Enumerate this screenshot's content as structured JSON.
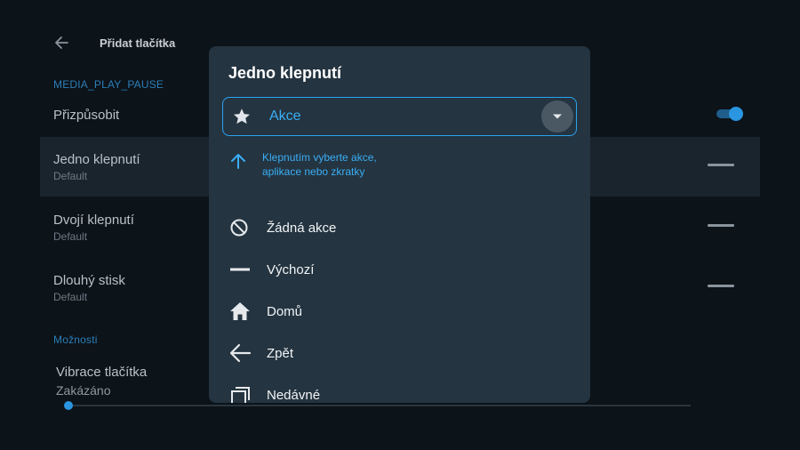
{
  "header": {
    "title": "Přidat tlačítka"
  },
  "sections": {
    "media_label": "MEDIA_PLAY_PAUSE",
    "options_label": "Možnosti"
  },
  "settings": {
    "customize": {
      "title": "Přizpůsobit",
      "enabled": true
    },
    "rows": [
      {
        "title": "Jedno klepnutí",
        "subtitle": "Default"
      },
      {
        "title": "Dvojí klepnutí",
        "subtitle": "Default"
      },
      {
        "title": "Dlouhý stisk",
        "subtitle": "Default"
      }
    ],
    "vibration": {
      "title": "Vibrace tlačítka",
      "subtitle": "Zakázáno",
      "level": 0
    }
  },
  "dialog": {
    "title": "Jedno klepnutí",
    "select_value": "Akce",
    "hint": "Klepnutím vyberte akce, aplikace nebo zkratky",
    "options": [
      {
        "label": "Žádná akce",
        "icon": "block-icon"
      },
      {
        "label": "Výchozí",
        "icon": "dash-icon"
      },
      {
        "label": "Domů",
        "icon": "home-icon"
      },
      {
        "label": "Zpět",
        "icon": "arrow-back-icon"
      },
      {
        "label": "Nedávné",
        "icon": "recents-icon"
      }
    ]
  },
  "colors": {
    "accent": "#2aa3f0",
    "dialog_bg": "#243440",
    "page_bg": "#0c1319"
  }
}
